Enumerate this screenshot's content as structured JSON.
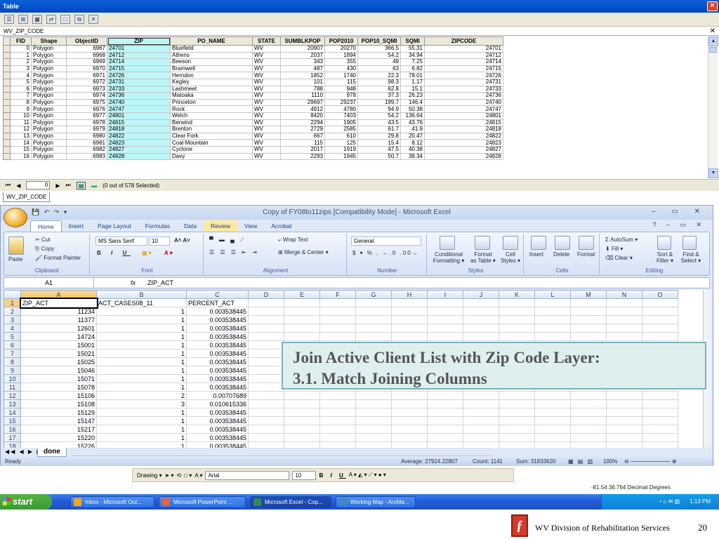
{
  "arcmap": {
    "window_title": "Table",
    "table_tab": "WV_ZIP_CODE",
    "bottom_tab": "WV_ZIP_CODE",
    "columns": [
      "FID",
      "Shape",
      "ObjectID",
      "ZIP",
      "PO_NAME",
      "STATE",
      "SUMBLKPOP",
      "POP2010",
      "POP10_SQMI",
      "SQMI",
      "ZIPCODE"
    ],
    "rows": [
      [
        "0",
        "Polygon",
        "6967",
        "24701",
        "Bluefield",
        "WV",
        "20907",
        "20270",
        "366.5",
        "55.31",
        "24701"
      ],
      [
        "1",
        "Polygon",
        "6968",
        "24712",
        "Athens",
        "WV",
        "2037",
        "1894",
        "54.2",
        "34.94",
        "24712"
      ],
      [
        "2",
        "Polygon",
        "6969",
        "24714",
        "Beeson",
        "WV",
        "343",
        "355",
        "49",
        "7.25",
        "24714"
      ],
      [
        "3",
        "Polygon",
        "6970",
        "24715",
        "Bramwell",
        "WV",
        "487",
        "430",
        "63",
        "6.82",
        "24715"
      ],
      [
        "4",
        "Polygon",
        "6971",
        "24726",
        "Herndon",
        "WV",
        "1852",
        "1740",
        "22.3",
        "78.01",
        "24726"
      ],
      [
        "5",
        "Polygon",
        "6972",
        "24731",
        "Kegley",
        "WV",
        "101",
        "115",
        "98.3",
        "1.17",
        "24731"
      ],
      [
        "6",
        "Polygon",
        "6973",
        "24733",
        "Lashmeet",
        "WV",
        "788",
        "948",
        "62.8",
        "15.1",
        "24733"
      ],
      [
        "7",
        "Polygon",
        "6974",
        "24736",
        "Matoaka",
        "WV",
        "1110",
        "978",
        "37.3",
        "26.23",
        "24736"
      ],
      [
        "8",
        "Polygon",
        "6975",
        "24740",
        "Princeton",
        "WV",
        "29697",
        "29237",
        "199.7",
        "146.4",
        "24740"
      ],
      [
        "9",
        "Polygon",
        "6976",
        "24747",
        "Rock",
        "WV",
        "4912",
        "4780",
        "94.9",
        "50.38",
        "24747"
      ],
      [
        "10",
        "Polygon",
        "6977",
        "24801",
        "Welch",
        "WV",
        "8420",
        "7403",
        "54.2",
        "136.64",
        "24801"
      ],
      [
        "11",
        "Polygon",
        "6978",
        "24815",
        "Berwind",
        "WV",
        "2294",
        "1905",
        "43.5",
        "43.76",
        "24815"
      ],
      [
        "12",
        "Polygon",
        "6979",
        "24818",
        "Brenton",
        "WV",
        "2729",
        "2585",
        "61.7",
        "41.9",
        "24818"
      ],
      [
        "13",
        "Polygon",
        "6980",
        "24822",
        "Clear Fork",
        "WV",
        "667",
        "610",
        "29.8",
        "20.47",
        "24822"
      ],
      [
        "14",
        "Polygon",
        "6981",
        "24823",
        "Coal Mountain",
        "WV",
        "115",
        "125",
        "15.4",
        "8.12",
        "24823"
      ],
      [
        "15",
        "Polygon",
        "6982",
        "24827",
        "Cyclone",
        "WV",
        "2017",
        "1919",
        "47.5",
        "40.38",
        "24827"
      ],
      [
        "16",
        "Polygon",
        "6983",
        "24828",
        "Davy",
        "WV",
        "2293",
        "1945",
        "50.7",
        "38.34",
        "24828"
      ]
    ],
    "nav": {
      "record": "0",
      "selected_text": "(0 out of 578 Selected)"
    }
  },
  "excel": {
    "window_title": "Copy of FY08to11zips  [Compatibility Mode] - Microsoft Excel",
    "tabs": [
      "Home",
      "Insert",
      "Page Layout",
      "Formulas",
      "Data",
      "Review",
      "View",
      "Acrobat"
    ],
    "ribbon": {
      "cut": "Cut",
      "copy": "Copy",
      "format_painter": "Format Painter",
      "paste": "Paste",
      "clipboard": "Clipboard",
      "font_name": "MS Sans Serif",
      "font_size": "10",
      "font": "Font",
      "wrap_text": "Wrap Text",
      "merge_center": "Merge & Center",
      "alignment": "Alignment",
      "number_format": "General",
      "number": "Number",
      "conditional": "Conditional",
      "formatting": "Formatting",
      "format_as": "Format",
      "as_table": "as Table",
      "cell": "Cell",
      "styles_l": "Styles",
      "styles": "Styles",
      "insert": "Insert",
      "delete": "Delete",
      "format": "Format",
      "cells": "Cells",
      "autosum": "AutoSum",
      "fill": "Fill",
      "clear": "Clear",
      "sort": "Sort &",
      "filter": "Filter",
      "find": "Find &",
      "select": "Select",
      "editing": "Editing"
    },
    "name_box": "A1",
    "formula": "ZIP_ACT",
    "col_letters": [
      "A",
      "B",
      "C",
      "D",
      "E",
      "F",
      "G",
      "H",
      "I",
      "J",
      "K",
      "L",
      "M",
      "N",
      "O"
    ],
    "rows": [
      [
        "ZIP_ACT",
        "ACT_CASES08_11",
        "PERCENT_ACT"
      ],
      [
        "11234",
        "1",
        "0.003538445"
      ],
      [
        "11377",
        "1",
        "0.003538445"
      ],
      [
        "12601",
        "1",
        "0.003538445"
      ],
      [
        "14724",
        "1",
        "0.003538445"
      ],
      [
        "15001",
        "1",
        "0.003538445"
      ],
      [
        "15021",
        "1",
        "0.003538445"
      ],
      [
        "15025",
        "1",
        "0.003538445"
      ],
      [
        "15046",
        "1",
        "0.003538445"
      ],
      [
        "15071",
        "1",
        "0.003538445"
      ],
      [
        "15078",
        "1",
        "0.003538445"
      ],
      [
        "15106",
        "2",
        "0.00707689"
      ],
      [
        "15108",
        "3",
        "0.010615336"
      ],
      [
        "15129",
        "1",
        "0.003538445"
      ],
      [
        "15147",
        "1",
        "0.003538445"
      ],
      [
        "15217",
        "1",
        "0.003538445"
      ],
      [
        "15220",
        "1",
        "0.003538445"
      ],
      [
        "15226",
        "1",
        "0.003538445"
      ]
    ],
    "sheet_tab": "done",
    "status": {
      "ready": "Ready",
      "average": "Average: 27924.22807",
      "count": "Count: 1141",
      "sum": "Sum: 31833620",
      "zoom": "100%"
    }
  },
  "callout": {
    "line1": "Join Active Client List with Zip Code Layer:",
    "line2": "3.1. Match Joining Columns"
  },
  "drawing_toolbar": {
    "drawing": "Drawing",
    "font": "Arial",
    "size": "10"
  },
  "coords": "-81.54  36.764 Decimal Degrees",
  "taskbar": {
    "start": "start",
    "items": [
      "Inbox - Microsoft Out...",
      "Microsoft PowerPoint ...",
      "Microsoft Excel - Cop...",
      "Working Map - ArcMa..."
    ],
    "clock": "1:13 PM"
  },
  "footer": {
    "org": "WV Division of Rehabilitation Services",
    "page": "20"
  }
}
